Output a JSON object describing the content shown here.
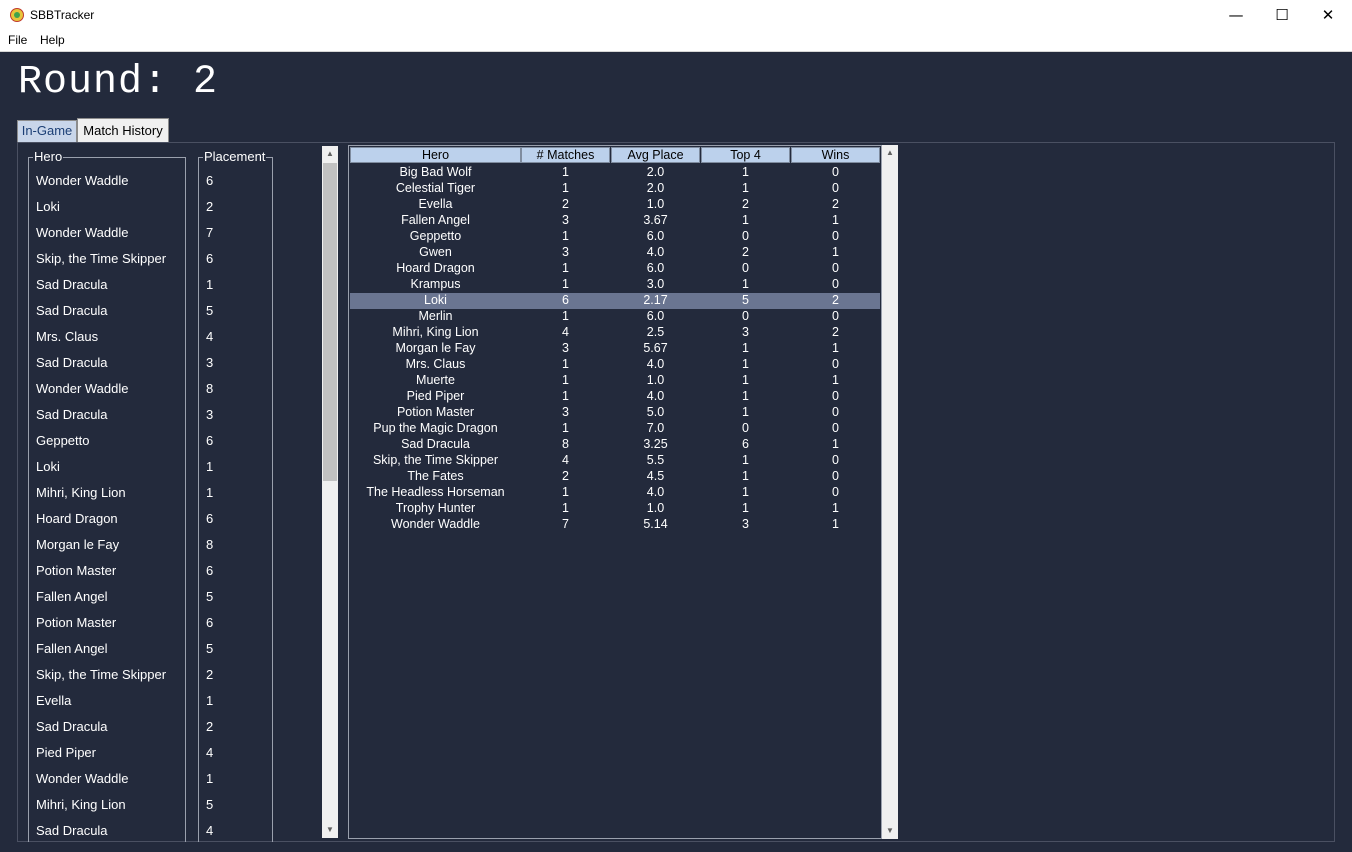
{
  "window": {
    "title": "SBBTracker",
    "minimize": "—",
    "maximize": "☐",
    "close": "✕"
  },
  "menu": {
    "file": "File",
    "help": "Help"
  },
  "round_label": "Round: 2",
  "tabs": {
    "in_game": "In-Game",
    "match_history": "Match History"
  },
  "history": {
    "hero_header": "Hero",
    "placement_header": "Placement",
    "rows": [
      {
        "hero": "Wonder Waddle",
        "place": "6"
      },
      {
        "hero": "Loki",
        "place": "2"
      },
      {
        "hero": "Wonder Waddle",
        "place": "7"
      },
      {
        "hero": "Skip, the Time Skipper",
        "place": "6"
      },
      {
        "hero": "Sad Dracula",
        "place": "1"
      },
      {
        "hero": "Sad Dracula",
        "place": "5"
      },
      {
        "hero": "Mrs. Claus",
        "place": "4"
      },
      {
        "hero": "Sad Dracula",
        "place": "3"
      },
      {
        "hero": "Wonder Waddle",
        "place": "8"
      },
      {
        "hero": "Sad Dracula",
        "place": "3"
      },
      {
        "hero": "Geppetto",
        "place": "6"
      },
      {
        "hero": "Loki",
        "place": "1"
      },
      {
        "hero": "Mihri, King Lion",
        "place": "1"
      },
      {
        "hero": "Hoard Dragon",
        "place": "6"
      },
      {
        "hero": "Morgan le Fay",
        "place": "8"
      },
      {
        "hero": "Potion Master",
        "place": "6"
      },
      {
        "hero": "Fallen Angel",
        "place": "5"
      },
      {
        "hero": "Potion Master",
        "place": "6"
      },
      {
        "hero": "Fallen Angel",
        "place": "5"
      },
      {
        "hero": "Skip, the Time Skipper",
        "place": "2"
      },
      {
        "hero": "Evella",
        "place": "1"
      },
      {
        "hero": "Sad Dracula",
        "place": "2"
      },
      {
        "hero": "Pied Piper",
        "place": "4"
      },
      {
        "hero": "Wonder Waddle",
        "place": "1"
      },
      {
        "hero": "Mihri, King Lion",
        "place": "5"
      },
      {
        "hero": "Sad Dracula",
        "place": "4"
      }
    ]
  },
  "stats": {
    "headers": [
      "Hero",
      "# Matches",
      "Avg Place",
      "Top 4",
      "Wins"
    ],
    "selected_row": "Loki",
    "rows": [
      [
        "Big Bad Wolf",
        "1",
        "2.0",
        "1",
        "0"
      ],
      [
        "Celestial Tiger",
        "1",
        "2.0",
        "1",
        "0"
      ],
      [
        "Evella",
        "2",
        "1.0",
        "2",
        "2"
      ],
      [
        "Fallen Angel",
        "3",
        "3.67",
        "1",
        "1"
      ],
      [
        "Geppetto",
        "1",
        "6.0",
        "0",
        "0"
      ],
      [
        "Gwen",
        "3",
        "4.0",
        "2",
        "1"
      ],
      [
        "Hoard Dragon",
        "1",
        "6.0",
        "0",
        "0"
      ],
      [
        "Krampus",
        "1",
        "3.0",
        "1",
        "0"
      ],
      [
        "Loki",
        "6",
        "2.17",
        "5",
        "2"
      ],
      [
        "Merlin",
        "1",
        "6.0",
        "0",
        "0"
      ],
      [
        "Mihri, King Lion",
        "4",
        "2.5",
        "3",
        "2"
      ],
      [
        "Morgan le Fay",
        "3",
        "5.67",
        "1",
        "1"
      ],
      [
        "Mrs. Claus",
        "1",
        "4.0",
        "1",
        "0"
      ],
      [
        "Muerte",
        "1",
        "1.0",
        "1",
        "1"
      ],
      [
        "Pied Piper",
        "1",
        "4.0",
        "1",
        "0"
      ],
      [
        "Potion Master",
        "3",
        "5.0",
        "1",
        "0"
      ],
      [
        "Pup the Magic Dragon",
        "1",
        "7.0",
        "0",
        "0"
      ],
      [
        "Sad Dracula",
        "8",
        "3.25",
        "6",
        "1"
      ],
      [
        "Skip, the Time Skipper",
        "4",
        "5.5",
        "1",
        "0"
      ],
      [
        "The Fates",
        "2",
        "4.5",
        "1",
        "0"
      ],
      [
        "The Headless Horseman",
        "1",
        "4.0",
        "1",
        "0"
      ],
      [
        "Trophy Hunter",
        "1",
        "1.0",
        "1",
        "1"
      ],
      [
        "Wonder Waddle",
        "7",
        "5.14",
        "3",
        "1"
      ]
    ]
  },
  "colors": {
    "background": "#232a3c",
    "header_bg": "#bcd1ec",
    "selected_row": "#6a7591",
    "text": "#ffffff"
  },
  "icons": {
    "scroll_up": "▲",
    "scroll_down": "▼"
  }
}
